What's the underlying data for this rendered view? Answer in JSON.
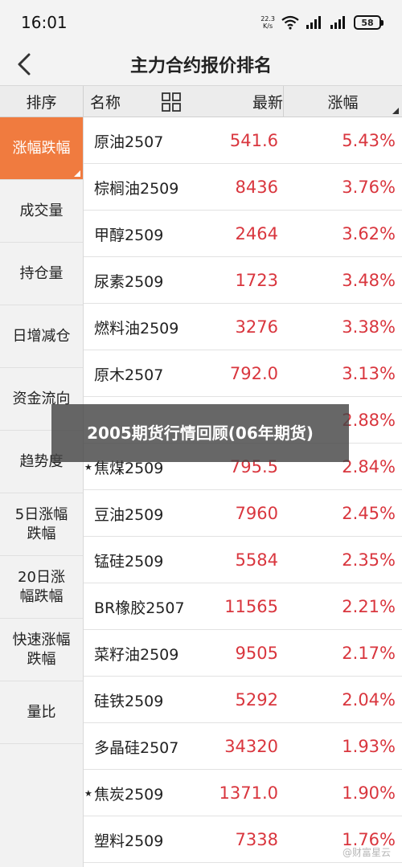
{
  "status_bar": {
    "time": "16:01",
    "net_speed_value": "22.3",
    "net_speed_unit": "K/s",
    "battery": "58"
  },
  "title_bar": {
    "title": "主力合约报价排名",
    "back_icon": "chevron-left-icon"
  },
  "table_header": {
    "sort": "排序",
    "name": "名称",
    "grid_icon": "grid-icon",
    "latest": "最新",
    "change": "涨幅"
  },
  "sidebar": {
    "items": [
      {
        "label": "涨幅跌幅",
        "active": true
      },
      {
        "label": "成交量",
        "active": false
      },
      {
        "label": "持仓量",
        "active": false
      },
      {
        "label": "日增减仓",
        "active": false
      },
      {
        "label": "资金流向",
        "active": false
      },
      {
        "label": "趋势度",
        "active": false
      },
      {
        "label": "5日涨幅\n跌幅",
        "active": false
      },
      {
        "label": "20日涨\n幅跌幅",
        "active": false
      },
      {
        "label": "快速涨幅\n跌幅",
        "active": false
      },
      {
        "label": "量比",
        "active": false
      }
    ]
  },
  "rows": [
    {
      "name": "原油2507",
      "latest": "541.6",
      "change": "5.43%",
      "star": false
    },
    {
      "name": "棕榈油2509",
      "latest": "8436",
      "change": "3.76%",
      "star": false
    },
    {
      "name": "甲醇2509",
      "latest": "2464",
      "change": "3.62%",
      "star": false
    },
    {
      "name": "尿素2509",
      "latest": "1723",
      "change": "3.48%",
      "star": false
    },
    {
      "name": "燃料油2509",
      "latest": "3276",
      "change": "3.38%",
      "star": false
    },
    {
      "name": "原木2507",
      "latest": "792.0",
      "change": "3.13%",
      "star": false
    },
    {
      "name": "",
      "latest": "",
      "change": "2.88%",
      "star": false
    },
    {
      "name": "焦煤2509",
      "latest": "795.5",
      "change": "2.84%",
      "star": true
    },
    {
      "name": "豆油2509",
      "latest": "7960",
      "change": "2.45%",
      "star": false
    },
    {
      "name": "锰硅2509",
      "latest": "5584",
      "change": "2.35%",
      "star": false
    },
    {
      "name": "BR橡胶2507",
      "latest": "11565",
      "change": "2.21%",
      "star": false
    },
    {
      "name": "菜籽油2509",
      "latest": "9505",
      "change": "2.17%",
      "star": false
    },
    {
      "name": "硅铁2509",
      "latest": "5292",
      "change": "2.04%",
      "star": false
    },
    {
      "name": "多晶硅2507",
      "latest": "34320",
      "change": "1.93%",
      "star": false
    },
    {
      "name": "焦炭2509",
      "latest": "1371.0",
      "change": "1.90%",
      "star": true
    },
    {
      "name": "塑料2509",
      "latest": "7338",
      "change": "1.76%",
      "star": false
    }
  ],
  "overlay": {
    "text": "2005期货行情回顾(06年期货)"
  },
  "watermark": "@财富星云",
  "colors": {
    "accent": "#f07b3f",
    "up": "#d9363e"
  }
}
